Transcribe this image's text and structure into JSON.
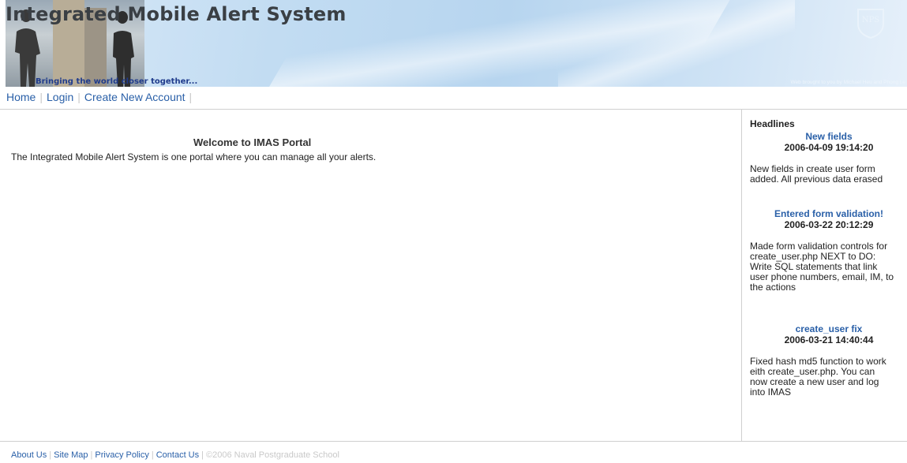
{
  "header": {
    "title": "Integrated Mobile Alert System",
    "tagline": "Bringing the world closer together...",
    "credit": "Web brought to you by Michael Heu and Phong Le",
    "logo_text": "NPS"
  },
  "nav": {
    "items": [
      "Home",
      "Login",
      "Create New Account"
    ]
  },
  "main": {
    "welcome_title": "Welcome to IMAS Portal",
    "welcome_text": "The Integrated Mobile Alert System is one portal where you can manage all your alerts."
  },
  "sidebar": {
    "label": "Headlines",
    "news": [
      {
        "title": "New fields",
        "date": "2006-04-09 19:14:20",
        "body": "New fields in create user form\nadded. All previous data erased"
      },
      {
        "title": "Entered form validation!",
        "date": "2006-03-22 20:12:29",
        "body": "Made form validation controls for\ncreate_user.php NEXT to DO:\nWrite SQL statements that link\nuser phone numbers, email, IM, to\nthe actions"
      },
      {
        "title": "create_user fix",
        "date": "2006-03-21 14:40:44",
        "body": "Fixed hash md5 function to work\neith create_user.php. You can\nnow create a new user and log\ninto IMAS"
      }
    ]
  },
  "footer": {
    "links": [
      "About Us",
      "Site Map",
      "Privacy Policy",
      "Contact Us"
    ],
    "copyright": "©2006 Naval Postgraduate School"
  }
}
